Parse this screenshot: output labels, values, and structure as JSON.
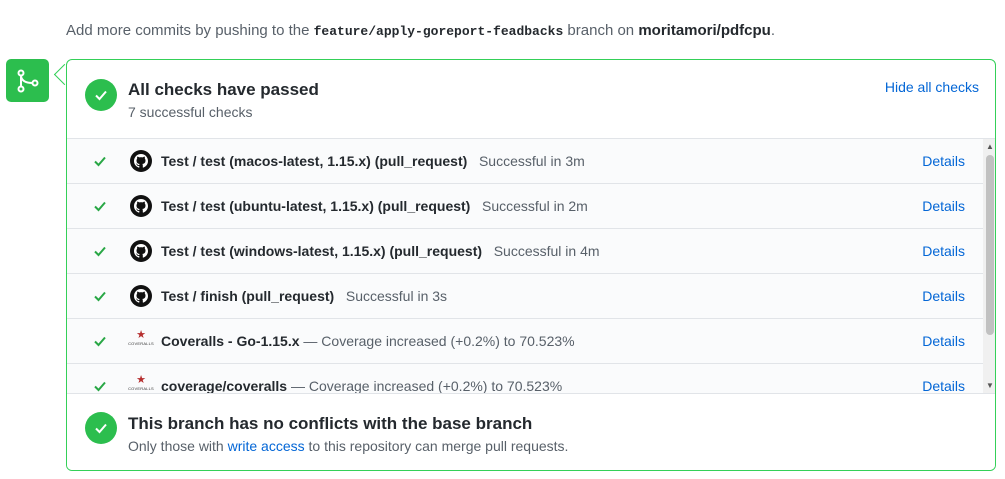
{
  "hint": {
    "prefix": "Add more commits by pushing to the ",
    "branch": "feature/apply-goreport-feadbacks",
    "middle": " branch on ",
    "repo": "moritamori/pdfcpu",
    "suffix": "."
  },
  "checks_header": {
    "title": "All checks have passed",
    "subtitle": "7 successful checks",
    "hide_label": "Hide all checks"
  },
  "checks": [
    {
      "name": "Test / test (macos-latest, 1.15.x) (pull_request)",
      "status": "Successful in 3m",
      "details": "Details",
      "avatar": "github-icon"
    },
    {
      "name": "Test / test (ubuntu-latest, 1.15.x) (pull_request)",
      "status": "Successful in 2m",
      "details": "Details",
      "avatar": "github-icon"
    },
    {
      "name": "Test / test (windows-latest, 1.15.x) (pull_request)",
      "status": "Successful in 4m",
      "details": "Details",
      "avatar": "github-icon"
    },
    {
      "name": "Test / finish (pull_request)",
      "status": "Successful in 3s",
      "details": "Details",
      "avatar": "github-icon"
    },
    {
      "name": "Coveralls - Go-1.15.x",
      "status": "— Coverage increased (+0.2%) to 70.523%",
      "details": "Details",
      "avatar": "coveralls-icon"
    },
    {
      "name": "coverage/coveralls",
      "status": "— Coverage increased (+0.2%) to 70.523%",
      "details": "Details",
      "avatar": "coveralls-icon"
    }
  ],
  "merge_footer": {
    "title": "This branch has no conflicts with the base branch",
    "sub_prefix": "Only those with ",
    "sub_link": "write access",
    "sub_suffix": " to this repository can merge pull requests."
  },
  "colors": {
    "success": "#2cbe4e",
    "border": "#34d058",
    "link": "#0366d6"
  }
}
